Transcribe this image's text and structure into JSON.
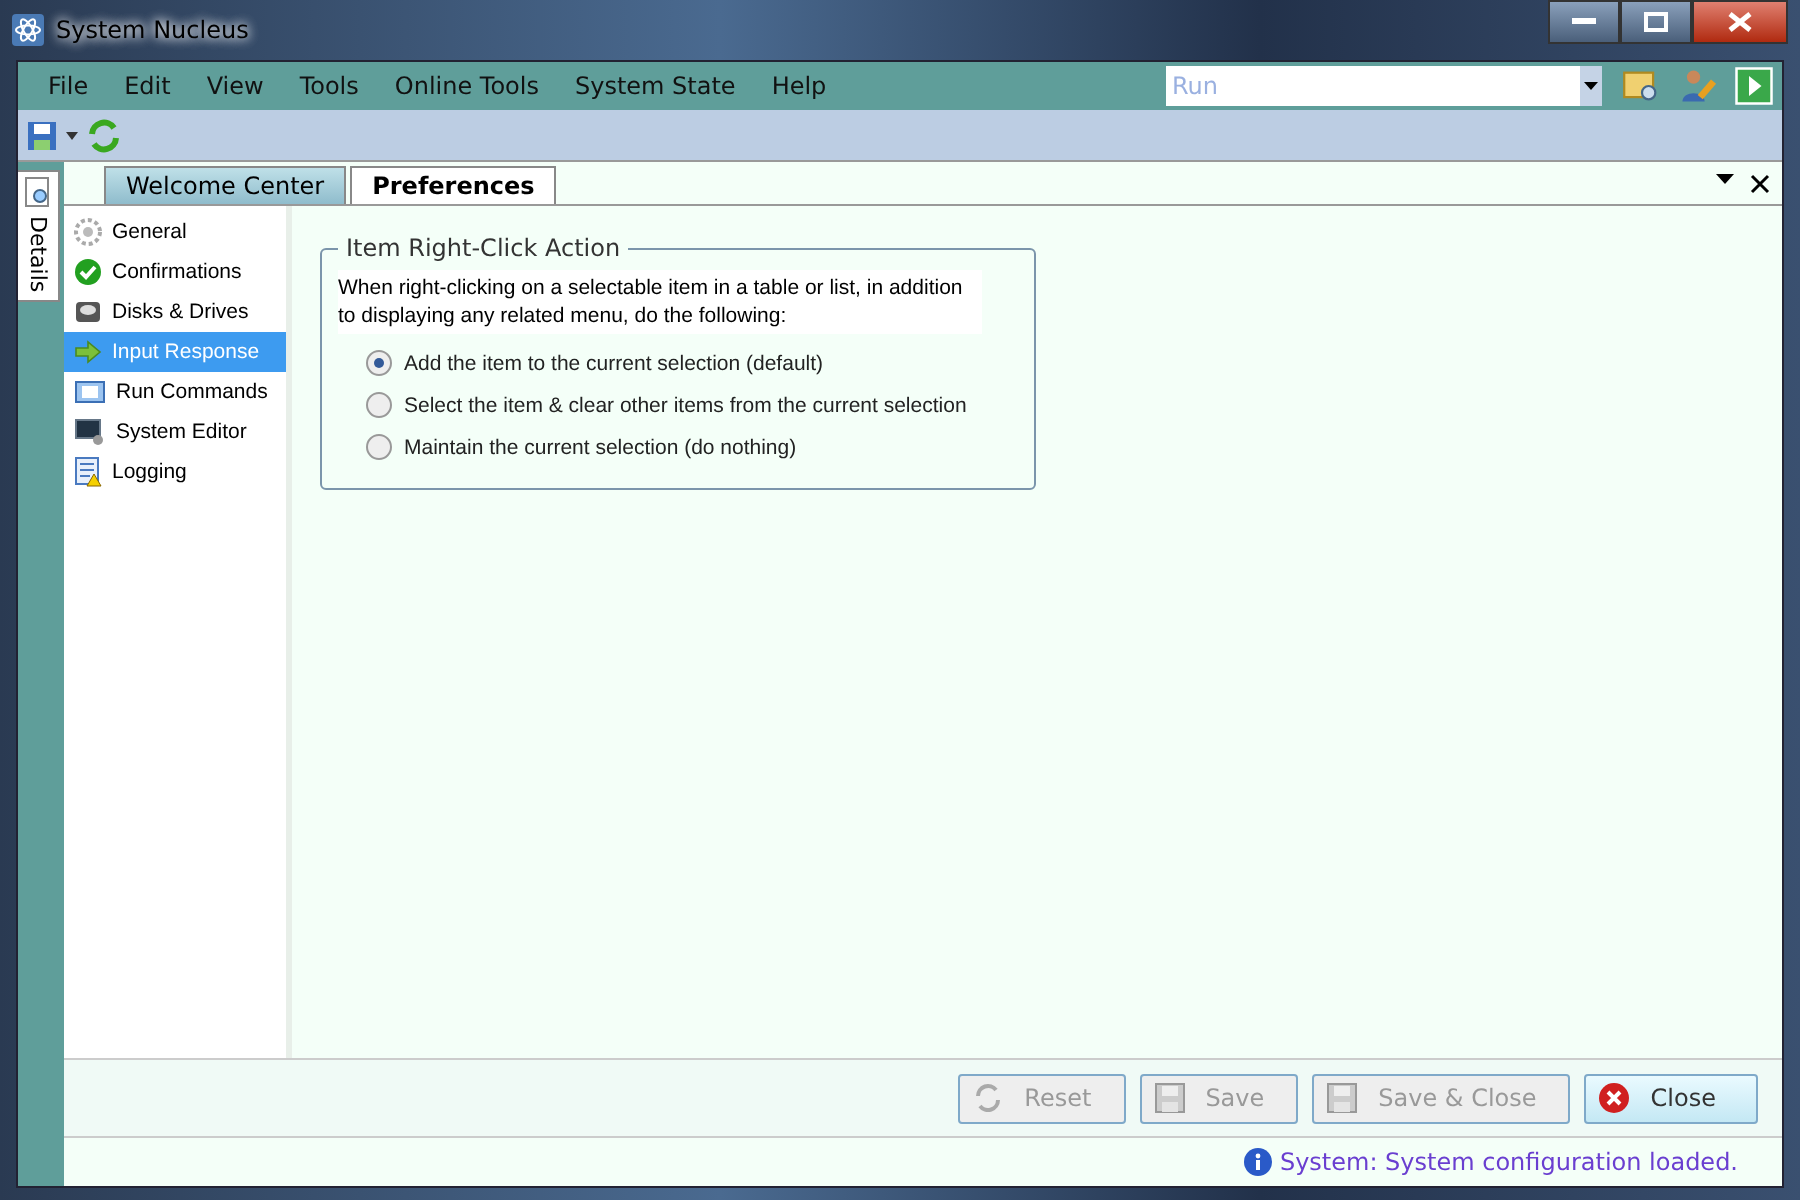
{
  "window": {
    "title": "System Nucleus"
  },
  "menu": [
    "File",
    "Edit",
    "View",
    "Tools",
    "Online Tools",
    "System State",
    "Help"
  ],
  "run_box": {
    "placeholder": "Run"
  },
  "side_tab": {
    "label": "Details"
  },
  "tabs": [
    {
      "label": "Welcome Center",
      "selected": false
    },
    {
      "label": "Preferences",
      "selected": true
    }
  ],
  "nav": [
    {
      "label": "General",
      "kind": "gear",
      "selected": false
    },
    {
      "label": "Confirmations",
      "kind": "check",
      "selected": false
    },
    {
      "label": "Disks & Drives",
      "kind": "disk",
      "selected": false
    },
    {
      "label": "Input Response",
      "kind": "arrow",
      "selected": true
    },
    {
      "label": "Run Commands",
      "kind": "run",
      "selected": false
    },
    {
      "label": "System Editor",
      "kind": "monitor",
      "selected": false
    },
    {
      "label": "Logging",
      "kind": "log",
      "selected": false
    }
  ],
  "group": {
    "title": "Item Right-Click Action",
    "description": "When right-clicking on a selectable item in a table or list, in addition to displaying any related menu, do the following:",
    "options": [
      {
        "label": "Add the item to the current selection (default)",
        "selected": true
      },
      {
        "label": "Select the item & clear other items from the current selection",
        "selected": false
      },
      {
        "label": "Maintain the current selection (do nothing)",
        "selected": false
      }
    ]
  },
  "buttons": [
    {
      "label": "Reset",
      "kind": "reset",
      "disabled": true
    },
    {
      "label": "Save",
      "kind": "save",
      "disabled": true
    },
    {
      "label": "Save & Close",
      "kind": "save",
      "disabled": true
    },
    {
      "label": "Close",
      "kind": "close",
      "disabled": false
    }
  ],
  "status_bar": {
    "message": "System: System configuration loaded."
  }
}
